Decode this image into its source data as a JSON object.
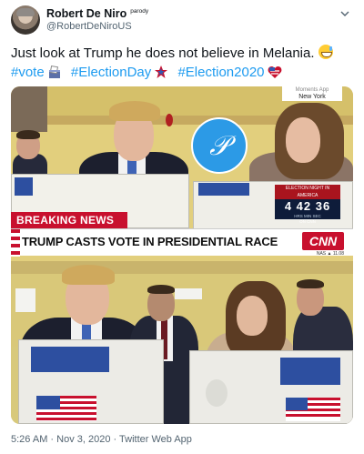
{
  "tweet": {
    "display_name": "Robert De Niro",
    "label": "parody",
    "handle": "@RobertDeNiroUS",
    "text": "Just look at Trump he does not believe in Melania.",
    "hashtags": [
      "#vote",
      "#ElectionDay",
      "#Election2020"
    ],
    "footer": "5:26 AM · Nov 3, 2020 · Twitter Web App"
  },
  "media": {
    "moments_label": "Moments App",
    "moments_location": "New York",
    "clock_title": "ELECTION NIGHT IN AMERICA",
    "clock_time": "4 42 36",
    "clock_sub": "HRS   MIN   SEC",
    "clock_channel": "ON CNN",
    "breaking_label": "BREAKING NEWS",
    "headline": "TRUMP CASTS VOTE IN PRESIDENTIAL RACE",
    "network": "CNN",
    "ticker": "NAS ▲ 11.08"
  },
  "colors": {
    "link": "#1d9bf0",
    "breaking_red": "#c8102e",
    "text_secondary": "#536471"
  },
  "icons": [
    "more-chevron-icon",
    "ballot-box-icon",
    "flag-star-icon",
    "flag-heart-icon",
    "grinning-sweat-icon"
  ]
}
